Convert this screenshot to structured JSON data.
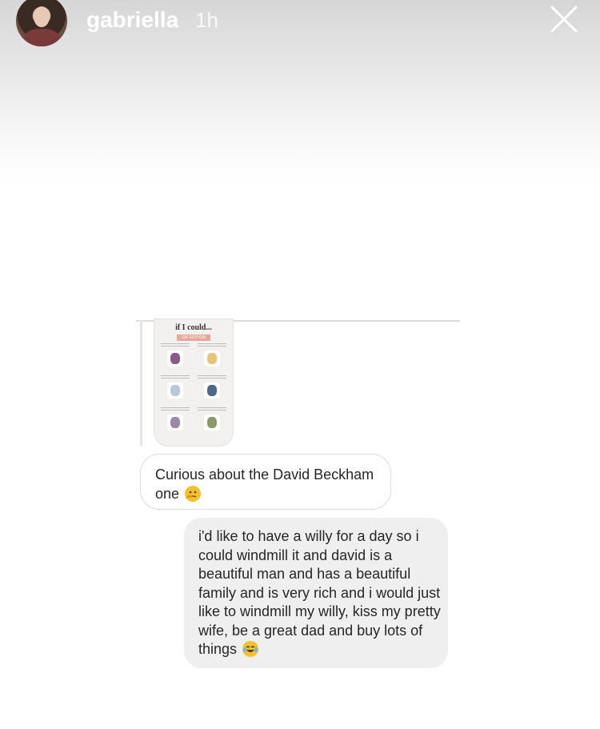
{
  "story": {
    "username": "gabriella",
    "time_ago": "1h",
    "close_icon": "close-icon"
  },
  "shared_post": {
    "title": "if I could...",
    "tag": "GIF EDITION"
  },
  "messages": [
    {
      "direction": "received",
      "text": "Curious about the David Beckham one",
      "emoji": "thinking-face"
    },
    {
      "direction": "sent",
      "text": "i'd like to have a willy for a day so i could windmill it and david is a beautiful man and has a beautiful family and is very rich and i would just like to windmill my willy, kiss my pretty wife, be a great dad and buy lots of things",
      "emoji": "tears-of-joy"
    }
  ],
  "colors": {
    "sent_bubble": "#efefef",
    "received_border": "#dbdbdb",
    "text": "#262626"
  }
}
